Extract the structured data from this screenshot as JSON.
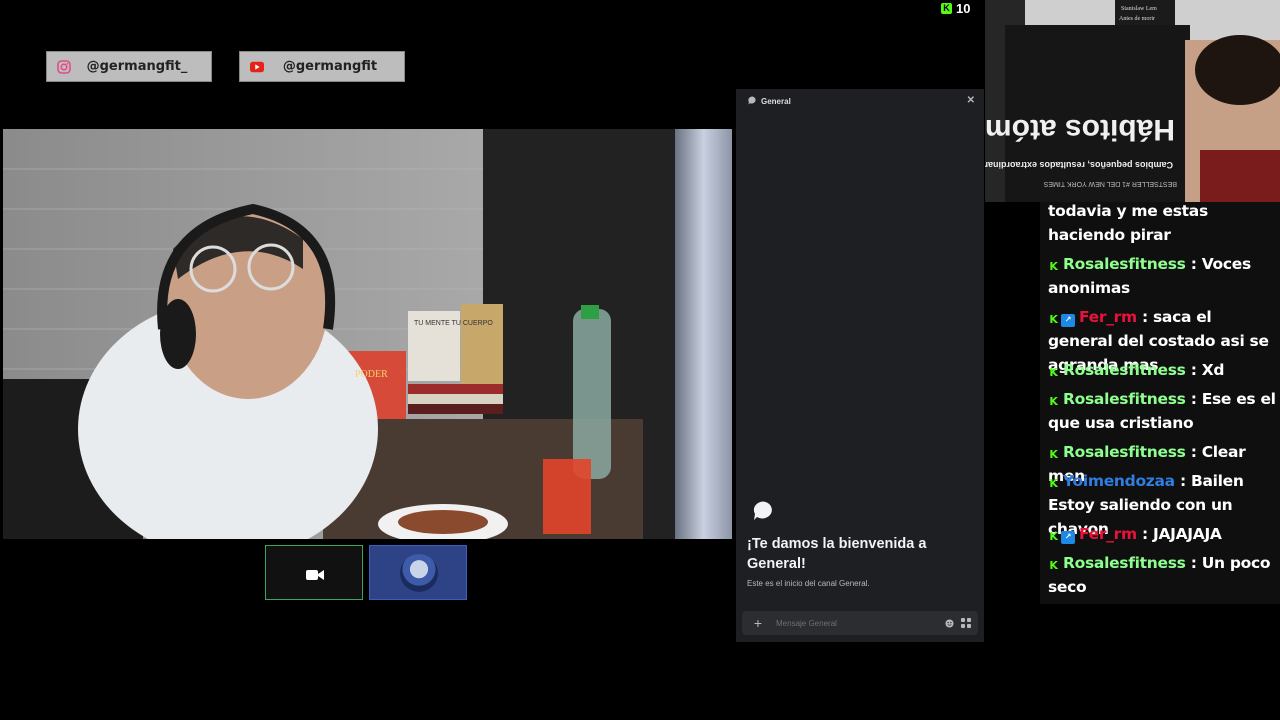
{
  "socials": [
    {
      "platform_icon": "instagram-icon",
      "handle": "@germangfit_"
    },
    {
      "platform_icon": "youtube-icon",
      "handle": "@germangfit"
    }
  ],
  "viewers": {
    "count": "10"
  },
  "video": {
    "book1_title": "TU MENTE TU CUERPO",
    "book2_title": "PODER"
  },
  "discord": {
    "channel": "General",
    "welcome_title": "¡Te damos la bienvenida a General!",
    "welcome_sub": "Este es el inicio del canal General.",
    "placeholder": "Mensaje General"
  },
  "camera_book": {
    "top_small": "Stanislaw Lem",
    "top_small2": "Antes de morir",
    "bestseller": "BESTSELLER #1 DEL NEW YORK TIMES",
    "subtitle": "Cambios pequeños, resultados extraordinarios",
    "title": "Hábitos atómicos"
  },
  "chat": [
    {
      "user": "",
      "color": "#ffffff",
      "text": "todavia y me estas haciendo pirar",
      "badges": []
    },
    {
      "user": "Rosalesfitness",
      "color": "#8eff8e",
      "text": ": Voces anonimas",
      "badges": [
        "kick"
      ]
    },
    {
      "user": "Fer_rm",
      "color": "#e8123b",
      "text": ": saca el general del costado asi se agranda mas",
      "badges": [
        "kick",
        "boost"
      ]
    },
    {
      "user": "Rosalesfitness",
      "color": "#8eff8e",
      "text": ": Xd",
      "badges": [
        "kick"
      ]
    },
    {
      "user": "Rosalesfitness",
      "color": "#8eff8e",
      "text": ": Ese es el que usa cristiano",
      "badges": [
        "kick"
      ]
    },
    {
      "user": "Rosalesfitness",
      "color": "#8eff8e",
      "text": ": Clear men",
      "badges": [
        "kick"
      ]
    },
    {
      "user": "Yoimendozaa",
      "color": "#2f7de1",
      "text": ": Bailen Estoy saliendo con un chavon",
      "badges": [
        "kick"
      ]
    },
    {
      "user": "Fer_rm",
      "color": "#e8123b",
      "text": ": JAJAJAJA",
      "badges": [
        "kick",
        "boost"
      ]
    },
    {
      "user": "Rosalesfitness",
      "color": "#8eff8e",
      "text": ": Un poco seco",
      "badges": [
        "kick"
      ]
    }
  ]
}
